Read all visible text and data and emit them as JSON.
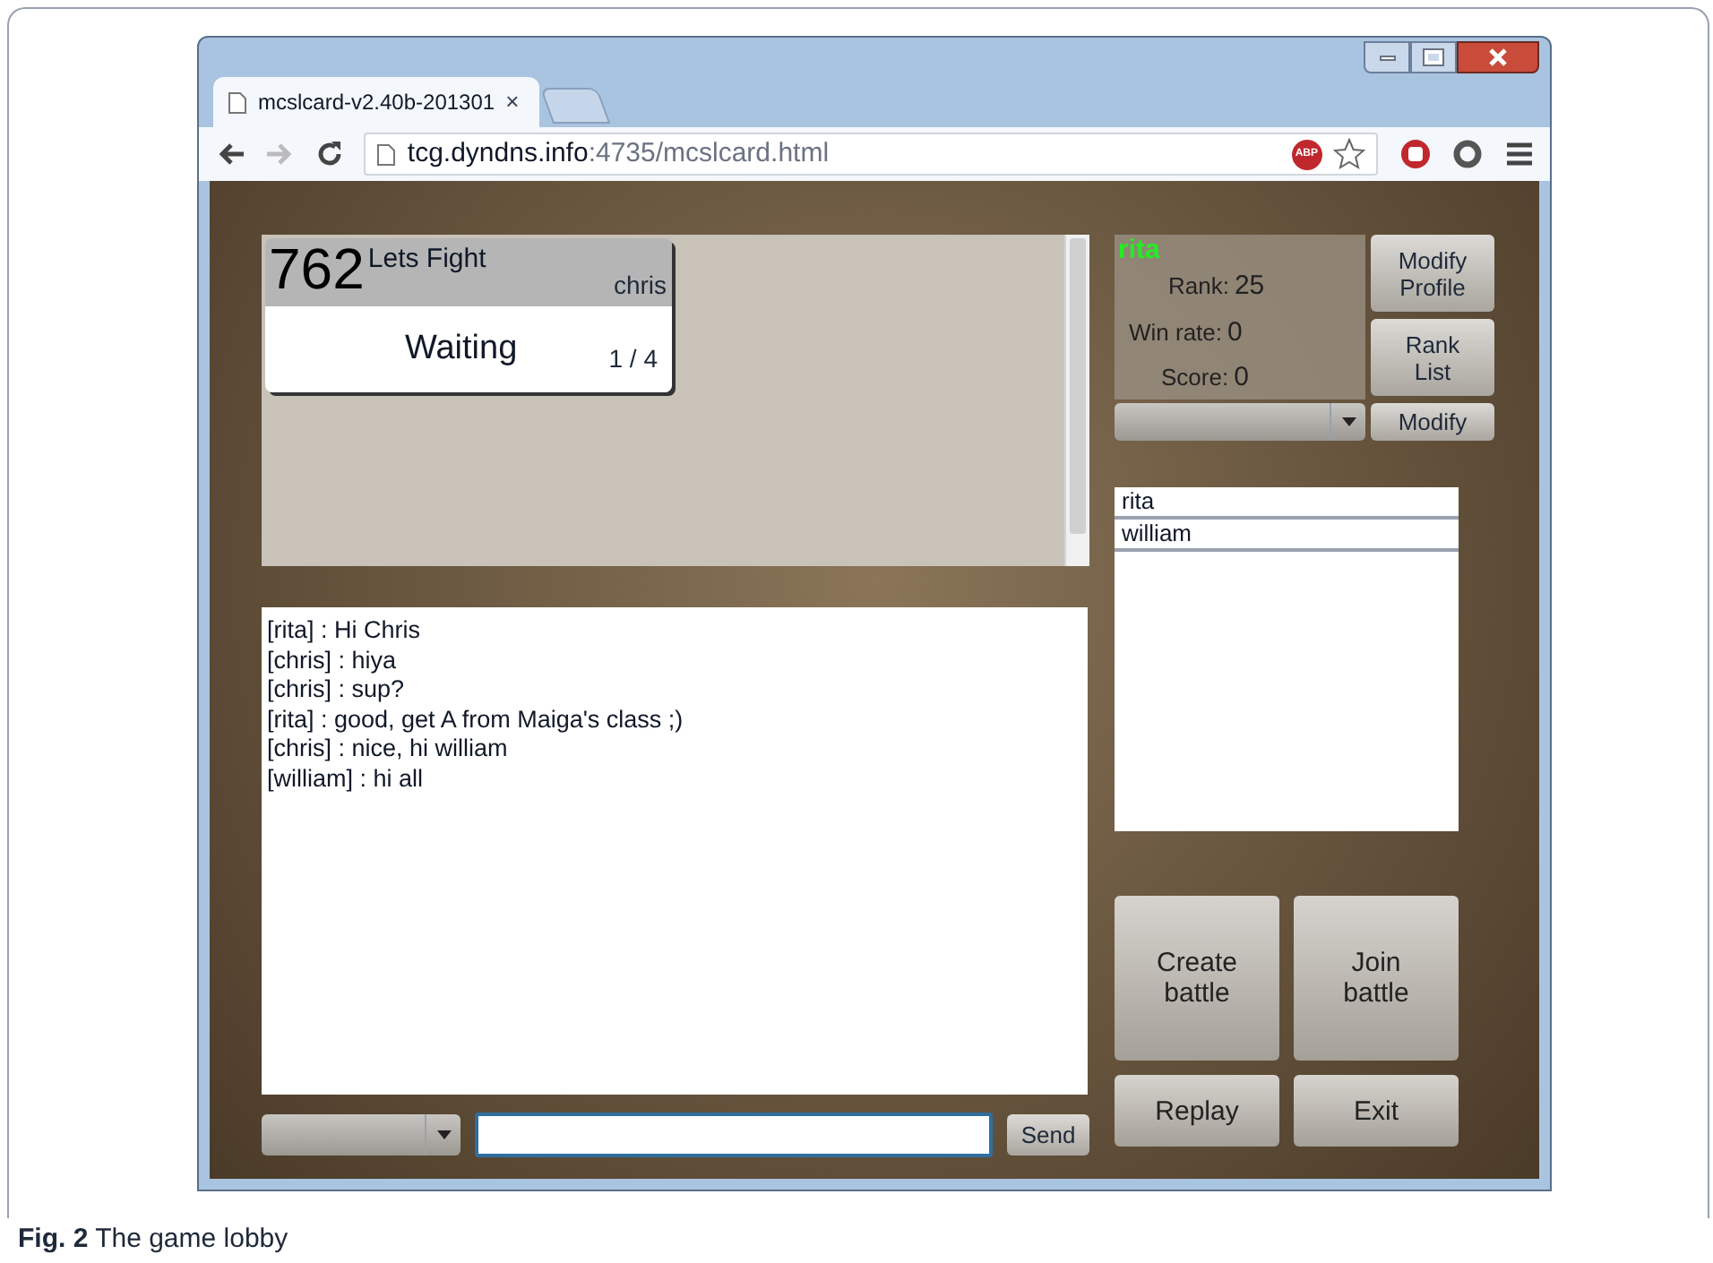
{
  "browser": {
    "tab_title": "mcslcard-v2.40b-201301",
    "tab_close": "×",
    "url_host": "tcg.dyndns.info",
    "url_path": ":4735/mcslcard.html",
    "abp": "ABP"
  },
  "rooms": [
    {
      "number": "762",
      "name": "Lets Fight",
      "host": "chris",
      "status": "Waiting",
      "players": "1 / 4"
    }
  ],
  "profile": {
    "name": "rita",
    "stats": [
      {
        "label": "Rank:",
        "value": "25"
      },
      {
        "label": "Win rate:",
        "value": "0"
      },
      {
        "label": "Score:",
        "value": "0"
      }
    ],
    "buttons": [
      "Modify Profile",
      "Rank List"
    ],
    "modify": "Modify"
  },
  "users": [
    "rita",
    "william"
  ],
  "chat": {
    "messages": [
      "[rita] : Hi Chris",
      "[chris] : hiya",
      "[chris] : sup?",
      "[rita] : good, get A from Maiga's class ;)",
      "[chris] : nice, hi william",
      "[william] : hi all"
    ],
    "send": "Send"
  },
  "actions": [
    {
      "label": "Create battle",
      "kind": "tall"
    },
    {
      "label": "Join battle",
      "kind": "tall"
    },
    {
      "label": "Replay",
      "kind": "short"
    },
    {
      "label": "Exit",
      "kind": "short"
    }
  ],
  "caption": "**Fig. 2** The game lobby"
}
